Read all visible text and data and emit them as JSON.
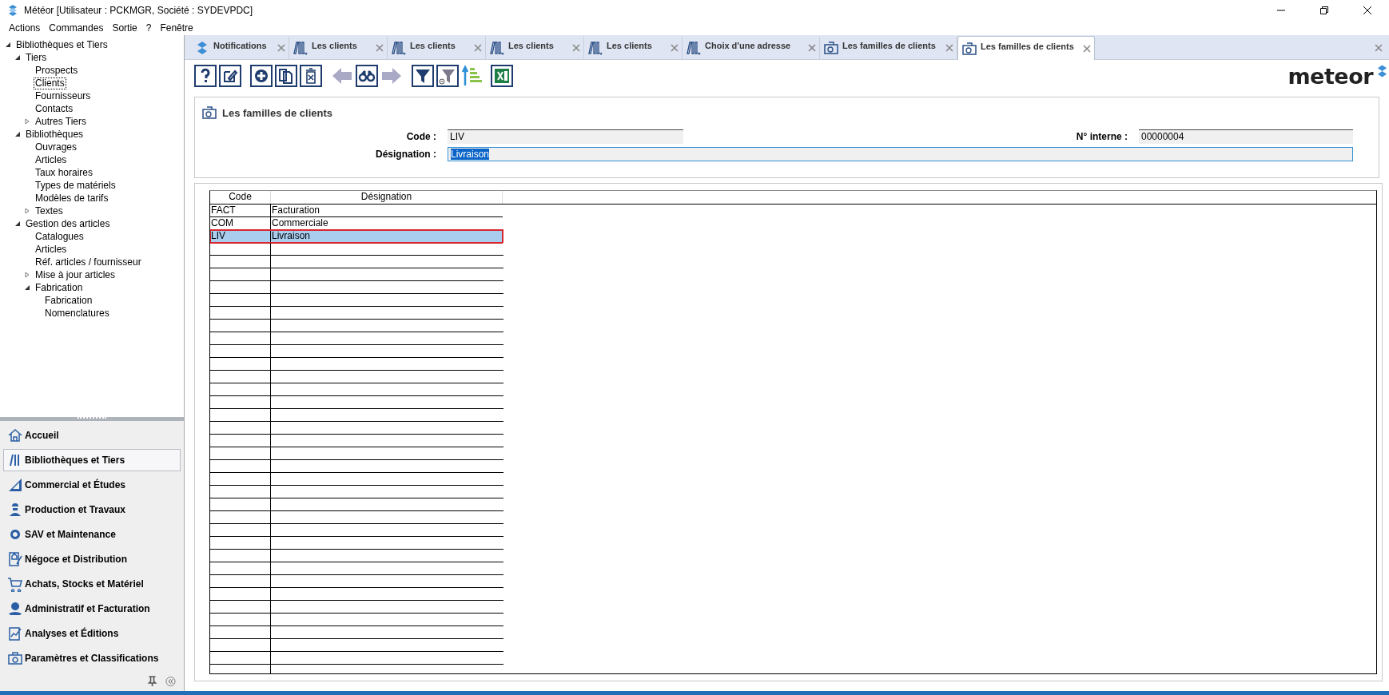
{
  "window": {
    "title": "Météor [Utilisateur : PCKMGR, Société : SYDEVPDC]"
  },
  "menu": [
    "Actions",
    "Commandes",
    "Sortie",
    "?",
    "Fenêtre"
  ],
  "tree": [
    {
      "label": "Bibliothèques et Tiers",
      "selected": false,
      "expanded": true,
      "children": [
        {
          "label": "Tiers",
          "selected": false,
          "expanded": true,
          "children": [
            {
              "label": "Prospects",
              "selected": false
            },
            {
              "label": "Clients",
              "selected": true
            },
            {
              "label": "Fournisseurs",
              "selected": false
            },
            {
              "label": "Contacts",
              "selected": false
            },
            {
              "label": "Autres Tiers",
              "selected": false,
              "expanded": false
            }
          ]
        },
        {
          "label": "Bibliothèques",
          "selected": false,
          "expanded": true,
          "children": [
            {
              "label": "Ouvrages",
              "selected": false
            },
            {
              "label": "Articles",
              "selected": false
            },
            {
              "label": "Taux horaires",
              "selected": false
            },
            {
              "label": "Types de matériels",
              "selected": false
            },
            {
              "label": "Modèles de tarifs",
              "selected": false
            },
            {
              "label": "Textes",
              "selected": false,
              "expanded": false
            }
          ]
        },
        {
          "label": "Gestion des articles",
          "selected": false,
          "expanded": true,
          "children": [
            {
              "label": "Catalogues",
              "selected": false
            },
            {
              "label": "Articles",
              "selected": false
            },
            {
              "label": "Réf. articles / fournisseur",
              "selected": false
            },
            {
              "label": "Mise à jour articles",
              "selected": false,
              "expanded": false
            },
            {
              "label": "Fabrication",
              "selected": false,
              "expanded": true,
              "children": [
                {
                  "label": "Fabrication",
                  "selected": false
                },
                {
                  "label": "Nomenclatures",
                  "selected": false
                }
              ]
            }
          ]
        }
      ]
    }
  ],
  "nav": [
    {
      "label": "Accueil",
      "selected": false
    },
    {
      "label": "Bibliothèques et Tiers",
      "selected": true
    },
    {
      "label": "Commercial et Études",
      "selected": false
    },
    {
      "label": "Production et Travaux",
      "selected": false
    },
    {
      "label": "SAV et Maintenance",
      "selected": false
    },
    {
      "label": "Négoce et Distribution",
      "selected": false
    },
    {
      "label": "Achats, Stocks et Matériel",
      "selected": false
    },
    {
      "label": "Administratif et Facturation",
      "selected": false
    },
    {
      "label": "Analyses et Éditions",
      "selected": false
    },
    {
      "label": "Paramètres et Classifications",
      "selected": false
    }
  ],
  "tabs": [
    {
      "label": "Notifications",
      "kind": "logo",
      "selected": false
    },
    {
      "label": "Les clients",
      "kind": "books",
      "selected": false
    },
    {
      "label": "Les clients",
      "kind": "books",
      "selected": false
    },
    {
      "label": "Les clients",
      "kind": "books",
      "selected": false
    },
    {
      "label": "Les clients",
      "kind": "books",
      "selected": false
    },
    {
      "label": "Choix d'une adresse",
      "kind": "books",
      "selected": false
    },
    {
      "label": "Les familles de clients",
      "kind": "settings",
      "selected": false
    },
    {
      "label": "Les familles de clients",
      "kind": "settings",
      "selected": true
    }
  ],
  "logo": "meteor",
  "form": {
    "title": "Les familles de clients",
    "code": {
      "label": "Code :",
      "value": "LIV"
    },
    "internal": {
      "label": "N° interne :",
      "value": "00000004"
    },
    "designation": {
      "label": "Désignation :",
      "value": "Livraison",
      "focused": true
    }
  },
  "table": {
    "columns": [
      "Code",
      "Désignation"
    ],
    "rows": [
      {
        "cells": [
          "FACT",
          "Facturation"
        ],
        "selected": false
      },
      {
        "cells": [
          "COM",
          "Commerciale"
        ],
        "selected": false
      },
      {
        "cells": [
          "LIV",
          "Livraison"
        ],
        "selected": true
      }
    ]
  }
}
